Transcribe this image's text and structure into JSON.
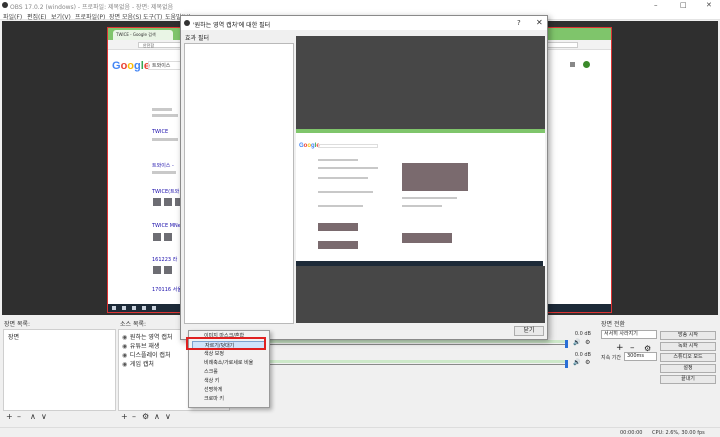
{
  "window": {
    "title": "OBS 17.0.2 (windows) - 프로파일: 제목없음 - 장면: 제목없음",
    "controls": {
      "minimize": "–",
      "maximize": "□",
      "close": "✕"
    }
  },
  "menubar": [
    "파일(F)",
    "편집(E)",
    "보기(V)",
    "프로파일(P)",
    "장면 모음(S)",
    "도구(T)",
    "도움말(H)"
  ],
  "capture": {
    "tab_label": "TWICE - Google 검색",
    "address": "안전함",
    "search_query": "트와이스",
    "links": [
      "TWICE",
      "트와이스 -",
      "TWICE(트와",
      "TWICE MNe",
      "161223 라",
      "170116 서울"
    ]
  },
  "docks": {
    "scenes": {
      "title": "장면 목록:",
      "items": [
        "장면"
      ]
    },
    "sources": {
      "title": "소스 목록:",
      "items": [
        "원하는 영역 캡처",
        "유튜브 재생",
        "디스플레이 캡처",
        "게임 캡처"
      ]
    },
    "toolbar": {
      "add": "+",
      "remove": "–",
      "settings": "⚙",
      "up": "∧",
      "down": "∨"
    },
    "mixer": {
      "db1": "0.0 dB",
      "db2": "0.0 dB"
    },
    "transitions": {
      "title": "장면 전환",
      "type": "서서히 사라지기",
      "duration_label": "지속 기간",
      "duration": "300ms"
    },
    "controls": [
      "방송 시작",
      "녹화 시작",
      "스튜디오 모드",
      "설정",
      "끝내기"
    ]
  },
  "statusbar": {
    "time": "00:00:00",
    "cpu": "CPU: 2.6%, 30.00 fps"
  },
  "dialog": {
    "title": "'원하는 영역 캡처'에 대한 필터",
    "help": "?",
    "close_x": "✕",
    "section": "효과 필터",
    "close_button": "닫기"
  },
  "context_menu": {
    "items": [
      "이미지 마스크/혼합",
      "자르기/덧대기",
      "색상 보정",
      "비례축소/가로세로 비율",
      "스크롤",
      "색상 키",
      "선명하게",
      "크로마 키"
    ],
    "highlighted_index": 1
  },
  "colors": {
    "accent_highlight": "#e02020",
    "tab_green": "#7fc56b",
    "preview_bg": "#2f2f2f"
  }
}
